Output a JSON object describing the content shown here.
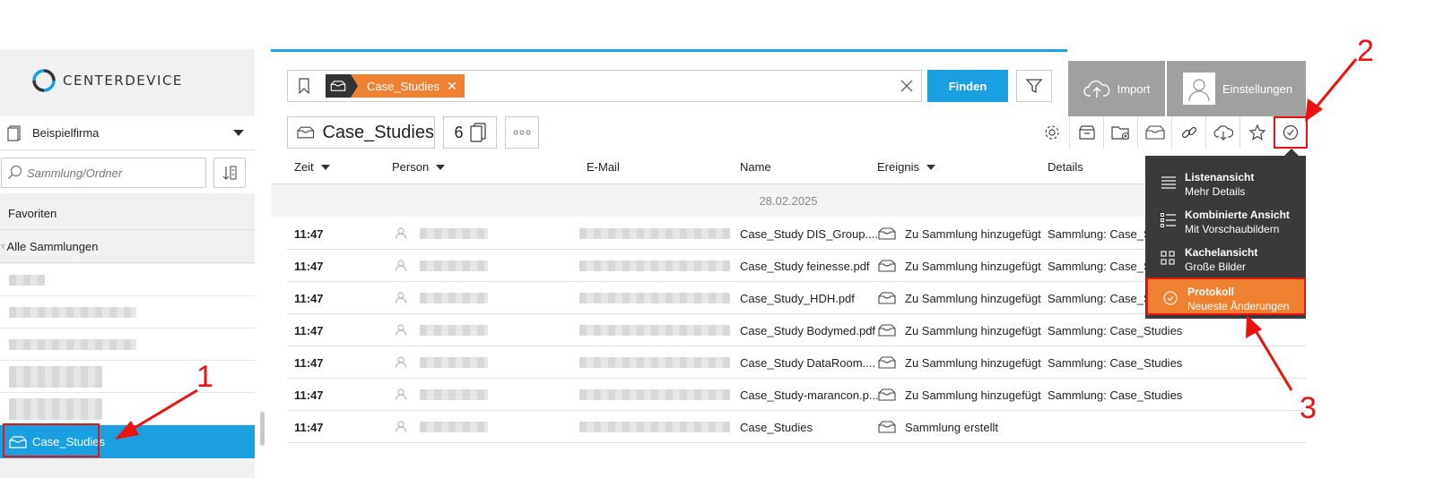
{
  "app": {
    "logo_text": "CENTERDEVICE"
  },
  "sidebar": {
    "company": "Beispielfirma",
    "search_placeholder": "Sammlung/Ordner",
    "favorites": "Favoriten",
    "all_collections": "Alle Sammlungen",
    "active_collection": "Case_Studies"
  },
  "search": {
    "chip_label": "Case_Studies",
    "find_label": "Finden"
  },
  "header": {
    "import_label": "Import",
    "settings_label": "Einstellungen",
    "collection_title": "Case_Studies",
    "doc_count": "6"
  },
  "table": {
    "columns": {
      "time": "Zeit",
      "person": "Person",
      "email": "E-Mail",
      "name": "Name",
      "event": "Ereignis",
      "details": "Details"
    },
    "date_group": "28.02.2025",
    "rows": [
      {
        "time": "11:47",
        "name": "Case_Study DIS_Group....",
        "event": "Zu Sammlung hinzugefügt",
        "details": "Sammlung: Case_Studies"
      },
      {
        "time": "11:47",
        "name": "Case_Study feinesse.pdf",
        "event": "Zu Sammlung hinzugefügt",
        "details": "Sammlung: Case_Studies"
      },
      {
        "time": "11:47",
        "name": "Case_Study_HDH.pdf",
        "event": "Zu Sammlung hinzugefügt",
        "details": "Sammlung: Case_Studies"
      },
      {
        "time": "11:47",
        "name": "Case_Study Bodymed.pdf",
        "event": "Zu Sammlung hinzugefügt",
        "details": "Sammlung: Case_Studies"
      },
      {
        "time": "11:47",
        "name": "Case_Study DataRoom....",
        "event": "Zu Sammlung hinzugefügt",
        "details": "Sammlung: Case_Studies"
      },
      {
        "time": "11:47",
        "name": "Case_Study-marancon.p...",
        "event": "Zu Sammlung hinzugefügt",
        "details": "Sammlung: Case_Studies"
      },
      {
        "time": "11:47",
        "name": "Case_Studies",
        "event": "Sammlung erstellt",
        "details": ""
      }
    ]
  },
  "view_menu": {
    "items": [
      {
        "title": "Listenansicht",
        "subtitle": "Mehr Details",
        "icon": "list-icon"
      },
      {
        "title": "Kombinierte Ansicht",
        "subtitle": "Mit Vorschaubildern",
        "icon": "combined-list-icon"
      },
      {
        "title": "Kachelansicht",
        "subtitle": "Große Bilder",
        "icon": "grid-icon"
      },
      {
        "title": "Protokoll",
        "subtitle": "Neueste Änderungen",
        "icon": "clock-icon"
      }
    ]
  },
  "annotations": {
    "n1": "1",
    "n2": "2",
    "n3": "3"
  },
  "colors": {
    "accent_blue": "#1a9fe0",
    "accent_orange": "#ef8232",
    "annotation_red": "#e11111"
  }
}
